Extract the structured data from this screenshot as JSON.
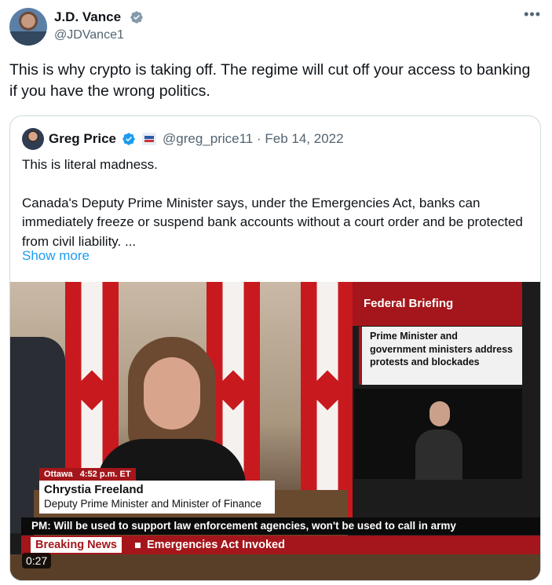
{
  "tweet": {
    "author_name": "J.D. Vance",
    "author_handle": "@JDVance1",
    "text": "This is why crypto is taking off. The regime will cut off your access to banking if you have the wrong politics.",
    "more_icon": "•••"
  },
  "quoted_tweet": {
    "author_name": "Greg Price",
    "author_handle": "@greg_price11",
    "separator": "·",
    "date": "Feb 14, 2022",
    "line1": "This is literal madness.",
    "line2": "Canada's Deputy Prime Minister says, under the Emergencies Act, banks can immediately freeze or suspend bank accounts without a court order and be protected from civil liability. ...",
    "show_more": "Show more"
  },
  "video": {
    "panel_title": "Federal Briefing",
    "panel_text": "Prime Minister and government ministers address protests and blockades",
    "chyron_location": "Ottawa",
    "chyron_time": "4:52 p.m. ET",
    "chyron_name": "Chrystia Freeland",
    "chyron_title": "Deputy Prime Minister and Minister of Finance",
    "ticker": "PM: Will be used to support law enforcement agencies, won't be used to call in army",
    "breaking_label": "Breaking News",
    "breaking_text": "Emergencies Act Invoked",
    "duration": "0:27"
  },
  "colors": {
    "verified": "#1d9bf0",
    "link": "#1d9bf0",
    "news_red": "#a4161b"
  }
}
